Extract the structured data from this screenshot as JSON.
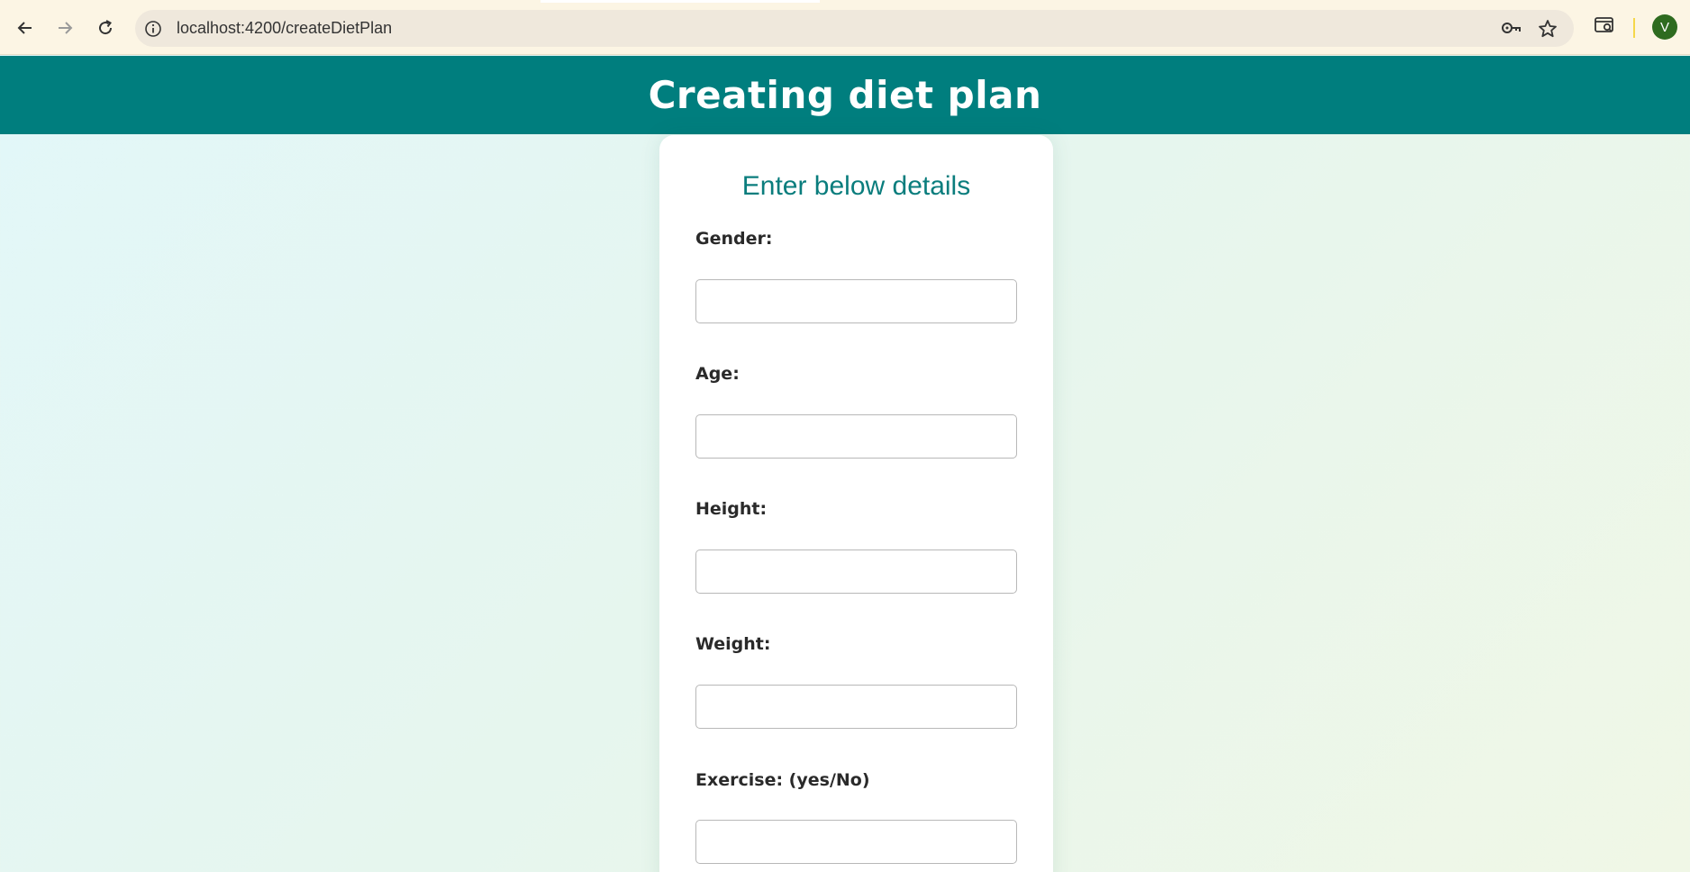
{
  "browser": {
    "url": "localhost:4200/createDietPlan",
    "profile_initial": "V",
    "icons": [
      "back-arrow-icon",
      "forward-arrow-icon",
      "reload-icon",
      "site-info-icon",
      "password-key-icon",
      "bookmark-star-icon",
      "tab-search-icon"
    ]
  },
  "header": {
    "title": "Creating diet plan"
  },
  "form": {
    "heading": "Enter below details",
    "fields": [
      {
        "label": "Gender:",
        "value": "",
        "placeholder": ""
      },
      {
        "label": "Age:",
        "value": "",
        "placeholder": ""
      },
      {
        "label": "Height:",
        "value": "",
        "placeholder": ""
      },
      {
        "label": "Weight:",
        "value": "",
        "placeholder": ""
      },
      {
        "label": "Exercise: (yes/No)",
        "value": "",
        "placeholder": ""
      }
    ]
  },
  "colors": {
    "header_bg": "#007e7e",
    "heading_text": "#0a7d7d",
    "browser_bg": "#fcf5e4",
    "avatar_bg": "#2e6b1f"
  }
}
